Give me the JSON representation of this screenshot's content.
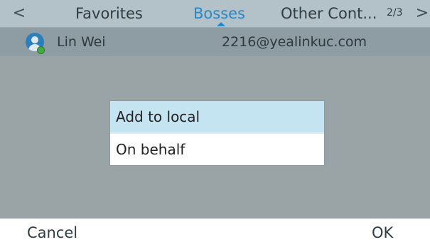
{
  "tabs": {
    "prev_icon": "chevron-left-icon",
    "next_icon": "chevron-right-icon",
    "prev_glyph": "<",
    "next_glyph": ">",
    "items": [
      {
        "label": "Favorites",
        "active": false
      },
      {
        "label": "Bosses",
        "active": true
      },
      {
        "label": "Other Cont...",
        "active": false
      }
    ],
    "page_indicator": "2/3",
    "active_color": "#2a86c4"
  },
  "contact": {
    "avatar_icon": "contact-avatar-icon",
    "presence_status": "online",
    "presence_color": "#3fae3f",
    "name": "Lin Wei",
    "email": "2216@yealinkuc.com"
  },
  "popup": {
    "items": [
      {
        "label": "Add to local",
        "selected": true
      },
      {
        "label": "On behalf",
        "selected": false
      }
    ],
    "highlight_color": "#c4e4f2"
  },
  "softkeys": {
    "left_label": "Cancel",
    "right_label": "OK"
  }
}
